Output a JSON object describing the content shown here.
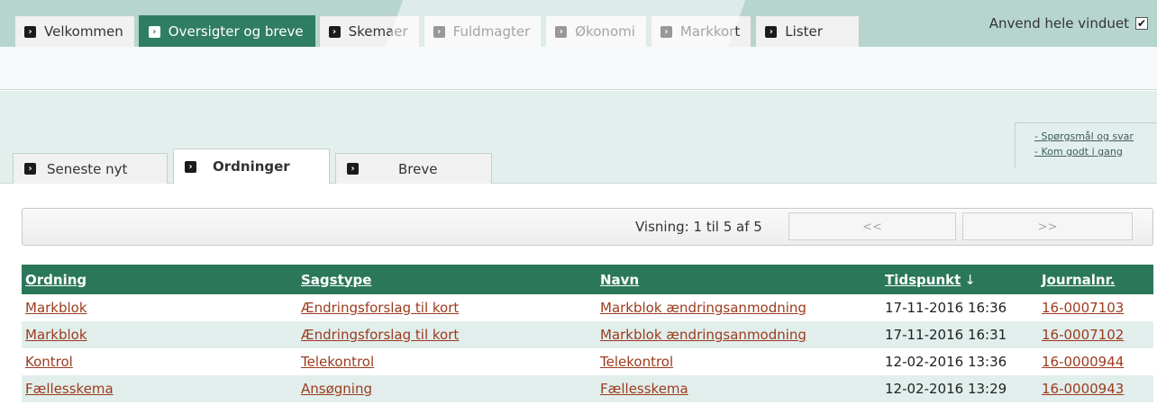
{
  "top_tabs": [
    {
      "label": "Velkommen",
      "active": false
    },
    {
      "label": "Oversigter og breve",
      "active": true
    },
    {
      "label": "Skemaer",
      "active": false
    },
    {
      "label": "Fuldmagter",
      "active": false
    },
    {
      "label": "Økonomi",
      "active": false
    },
    {
      "label": "Markkort",
      "active": false
    },
    {
      "label": "Lister",
      "active": false
    }
  ],
  "fullwindow": {
    "label": "Anvend hele vinduet",
    "checked": true
  },
  "help_links": [
    "- Spørgsmål og svar",
    "- Kom godt i gang"
  ],
  "sub_tabs": [
    {
      "label": "Seneste nyt",
      "active": false
    },
    {
      "label": "Ordninger",
      "active": true
    },
    {
      "label": "Breve",
      "active": false
    }
  ],
  "pager": {
    "info": "Visning: 1 til 5 af 5",
    "prev": "<<",
    "next": ">>"
  },
  "table": {
    "columns": [
      "Ordning",
      "Sagstype",
      "Navn",
      "Tidspunkt",
      "Journalnr."
    ],
    "sort_indicator": "↓",
    "rows": [
      [
        "Markblok",
        "Ændringsforslag til kort",
        "Markblok ændringsanmodning",
        "17-11-2016 16:36",
        "16-0007103"
      ],
      [
        "Markblok",
        "Ændringsforslag til kort",
        "Markblok ændringsanmodning",
        "17-11-2016 16:31",
        "16-0007102"
      ],
      [
        "Kontrol",
        "Telekontrol",
        "Telekontrol",
        "12-02-2016 13:36",
        "16-0000944"
      ],
      [
        "Fællesskema",
        "Ansøgning",
        "Fællesskema",
        "12-02-2016 13:29",
        "16-0000943"
      ]
    ]
  },
  "colors": {
    "accent": "#2f7d62",
    "header": "#2b775a",
    "link": "#9c3b1d",
    "alt_row": "#e1eeec"
  }
}
